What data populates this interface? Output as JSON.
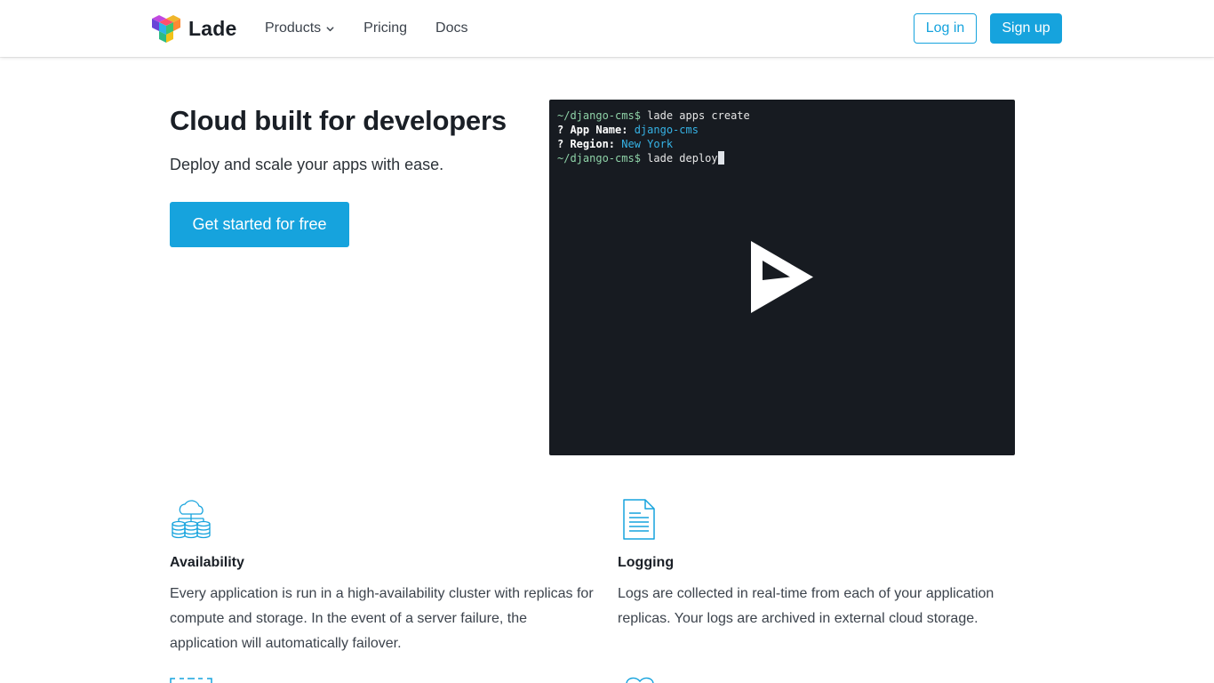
{
  "header": {
    "brand": "Lade",
    "nav": [
      {
        "label": "Products",
        "has_dropdown": true
      },
      {
        "label": "Pricing"
      },
      {
        "label": "Docs"
      }
    ],
    "login_label": "Log in",
    "signup_label": "Sign up"
  },
  "hero": {
    "title": "Cloud built for developers",
    "subtitle": "Deploy and scale your apps with ease.",
    "cta_label": "Get started for free"
  },
  "terminal": {
    "prompt": "~/django-cms$",
    "line1_cmd": " lade apps create",
    "line2_key": "? App Name:",
    "line2_val": " django-cms",
    "line3_key": "? Region:",
    "line3_val": " New York",
    "line4_cmd": " lade deploy"
  },
  "features": [
    {
      "icon": "cloud-database-icon",
      "title": "Availability",
      "text": "Every application is run in a high-availability cluster with replicas for compute and storage. In the event of a server failure, the application will automatically failover."
    },
    {
      "icon": "document-icon",
      "title": "Logging",
      "text": "Logs are collected in real-time from each of your application replicas. Your logs are archived in external cloud storage."
    }
  ],
  "colors": {
    "accent": "#16a3dd",
    "terminal_bg": "#171b21",
    "text_dark": "#1a1f26",
    "text_body": "#3c434c"
  }
}
